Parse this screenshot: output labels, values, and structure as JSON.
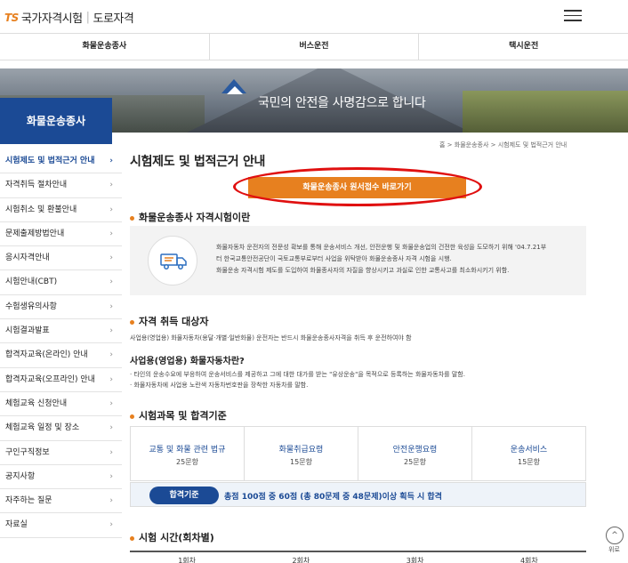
{
  "header": {
    "logo_ts": "TS",
    "logo_name": "국가자격시험",
    "logo_sep": "|",
    "logo_sub": "도로자격"
  },
  "gnb": [
    "화물운송종사",
    "버스운전",
    "택시운전"
  ],
  "banner": {
    "text": "국민의 안전을 사명감으로 합니다"
  },
  "sidebar": {
    "title": "화물운송종사",
    "items": [
      {
        "label": "시험제도 및 법적근거 안내",
        "active": true
      },
      {
        "label": "자격취득 절차안내"
      },
      {
        "label": "시험취소 및 환불안내"
      },
      {
        "label": "문제출제방법안내"
      },
      {
        "label": "응시자격안내"
      },
      {
        "label": "시험안내(CBT)"
      },
      {
        "label": "수험생유의사항"
      },
      {
        "label": "시험결과발표"
      },
      {
        "label": "합격자교육(온라인) 안내"
      },
      {
        "label": "합격자교육(오프라인) 안내"
      },
      {
        "label": "체험교육 신청안내"
      },
      {
        "label": "체험교육 일정 및 장소"
      },
      {
        "label": "구인구직정보"
      },
      {
        "label": "공지사항"
      },
      {
        "label": "자주하는 질문"
      },
      {
        "label": "자료실"
      }
    ]
  },
  "breadcrumb": "홈  >  화물운송종사  >  시험제도 및 법적근거 안내",
  "page_title": "시험제도 및 법적근거 안내",
  "apply_button": "화물운송종사 원서접수 바로가기",
  "section1": {
    "title": "화물운송종사 자격시험이란",
    "line1": "화물자동차 운전자의 전문성 확보를 통해 운송서비스 개선, 안전운행 및 화물운송업의 건전한 육성을 도모하기 위해 '04.7.21부",
    "line2": "터 한국교통안전공단이 국토교통부로부터 사업을 위탁받아 화물운송종사 자격 시험을 시행.",
    "line3": "화물운송 자격시험 제도를 도입하여 화물종사자의 자질을 향상시키고 과실로 인한 교통사고를 최소화시키기 위함."
  },
  "section2": {
    "title": "자격 취득 대상자",
    "desc": "사업용(영업용) 화물자동차(용달·개별·일반화물) 운전자는 반드시 화물운송종사자격을 취득 후 운전하여야 함",
    "sub_title": "사업용(영업용) 화물자동차란?",
    "bullet1": "· 타인의 운송수요에 부응하여 운송서비스를 제공하고 그에 대한 대가를 받는 \"유상운송\"을 목적으로 등록하는 화물자동차를 말함.",
    "bullet2": "· 화물자동차에 사업용 노란색 자동차번호판을 장착한 자동차를 말함."
  },
  "section3": {
    "title": "시험과목 및 합격기준",
    "subjects": [
      {
        "name": "교통 및 화물 관련 법규",
        "count": "25문항"
      },
      {
        "name": "화물취급요령",
        "count": "15문항"
      },
      {
        "name": "안전운행요령",
        "count": "25문항"
      },
      {
        "name": "운송서비스",
        "count": "15문항"
      }
    ],
    "pass_label": "합격기준",
    "pass_text": "총점 100점 중 60점 (총 80문제 중 48문제)이상 획득 시 합격"
  },
  "section4": {
    "title": "시험 시간(회차별)",
    "rounds": [
      "1회차",
      "2회차",
      "3회차",
      "4회차"
    ]
  },
  "top_button": {
    "icon": "^",
    "label": "위로"
  }
}
